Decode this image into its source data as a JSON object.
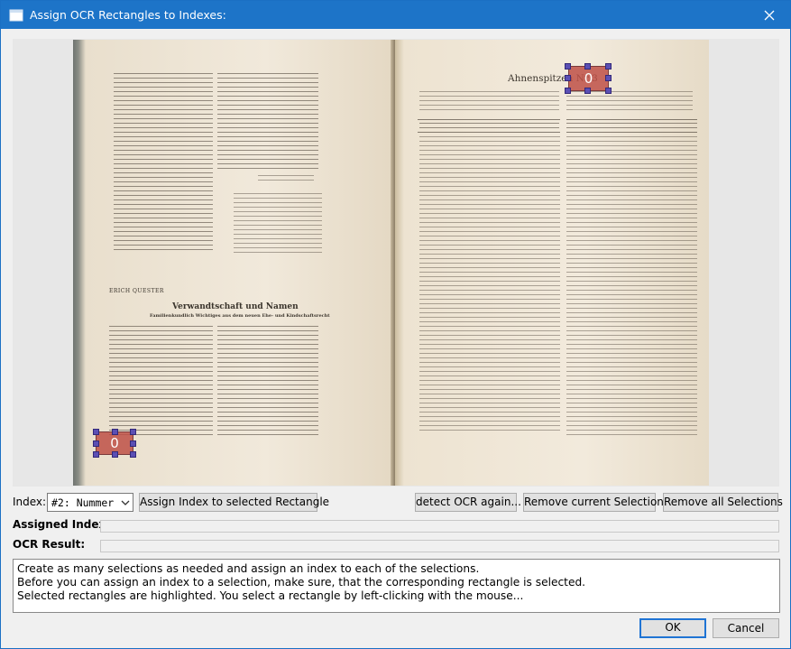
{
  "window": {
    "title": "Assign OCR Rectangles to Indexes:"
  },
  "scan": {
    "right_page_heading": "Ahnenspitzen Nr 3",
    "left_page_heading": "Verwandtschaft und Namen",
    "left_page_subheading": "Familienkundlich Wichtiges aus dem neuen Ehe- und Kindschaftsrecht",
    "left_page_author": "ERICH QUESTER"
  },
  "selections": [
    {
      "label": "0"
    },
    {
      "label": "0"
    }
  ],
  "controls": {
    "index_label": "Index:",
    "index_value": "#2: Nummer",
    "assign_button": "Assign Index to selected Rectangle",
    "detect_button": "detect OCR again...",
    "remove_current_button": "Remove current Selection",
    "remove_all_button": "Remove all Selections",
    "assigned_index_label": "Assigned Index:",
    "assigned_index_value": "",
    "ocr_result_label": "OCR Result:",
    "ocr_result_value": ""
  },
  "instructions": [
    "Create as many selections as needed and assign an index to each of the selections.",
    "Before you can assign an index to a selection, make sure, that the corresponding rectangle is selected.",
    "Selected rectangles are highlighted. You select a rectangle by left-clicking with the mouse..."
  ],
  "footer": {
    "ok_button": "OK",
    "cancel_button": "Cancel"
  },
  "icons": {
    "app": "app-window-icon",
    "close": "close-icon",
    "dropdown": "chevron-down-icon"
  },
  "colors": {
    "titlebar": "#1d74c8",
    "selection_fill": "#be5046",
    "handle": "#5b4fb4"
  }
}
